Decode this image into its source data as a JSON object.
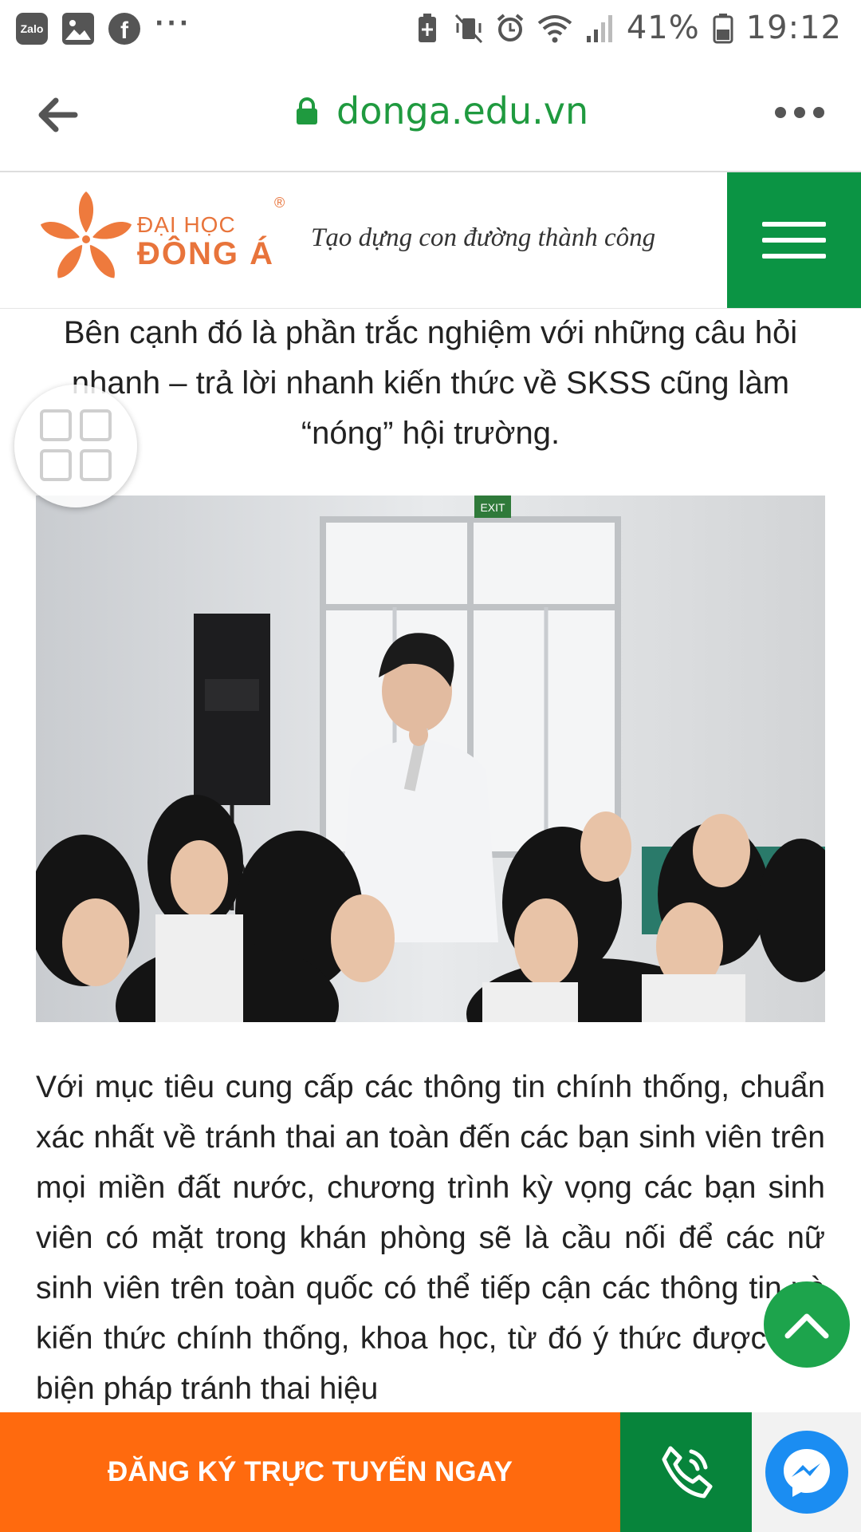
{
  "status_bar": {
    "app_icons": [
      "zalo-icon",
      "gallery-icon",
      "facebook-icon"
    ],
    "zalo_label": "Zalo",
    "facebook_glyph": "f",
    "more_dots": "···",
    "battery_percent": "41%",
    "time": "19:12"
  },
  "browser": {
    "url": "donga.edu.vn",
    "secure": true
  },
  "site_header": {
    "logo_line1": "ĐẠI HỌC",
    "logo_line2": "ĐÔNG Á",
    "logo_reg": "®",
    "slogan": "Tạo dựng con đường thành công",
    "menu_icon": "hamburger-icon"
  },
  "article": {
    "paragraph_top": "Bên cạnh đó là phần trắc nghiệm với những câu hỏi nhanh – trả lời nhanh kiến thức về SKSS cũng làm “nóng” hội trường.",
    "image_exit_sign": "EXIT",
    "paragraph_main": "Với mục tiêu cung cấp các thông tin chính thống, chuẩn xác nhất về tránh thai an toàn đến các bạn sinh viên trên mọi miền đất nước, chương trình kỳ vọng các bạn sinh viên có mặt trong khán phòng sẽ là cầu nối để các nữ sinh viên trên toàn quốc có thể tiếp cận các thông tin và kiến thức chính thống, khoa học, từ đó ý thức được các biện pháp tránh thai hiệu"
  },
  "bottom_bar": {
    "register_label": "ĐĂNG KÝ TRỰC TUYẾN NGAY",
    "call_icon": "phone-icon",
    "messenger_icon": "messenger-icon"
  },
  "colors": {
    "brand_green": "#0b9444",
    "brand_orange": "#e8743b",
    "cta_orange": "#ff6a0e",
    "url_green": "#1f9a3f"
  }
}
